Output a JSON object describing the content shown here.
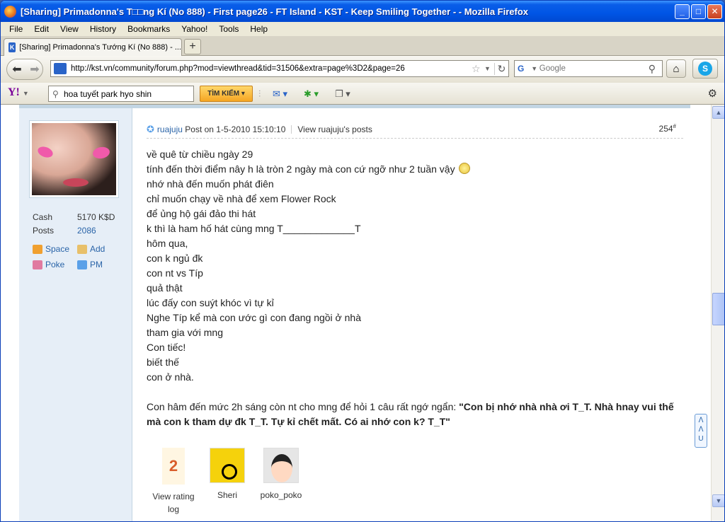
{
  "window": {
    "title": "[Sharing] Primadonna's T□□ng Kí (No 888) - First page26 - FT Island - KST - Keep Smiling Together - - Mozilla Firefox"
  },
  "menu": [
    "File",
    "Edit",
    "View",
    "History",
    "Bookmarks",
    "Yahoo!",
    "Tools",
    "Help"
  ],
  "tab": {
    "label": "[Sharing] Primadonna's Tướng Kí (No 888) - ..."
  },
  "nav": {
    "url": "http://kst.vn/community/forum.php?mod=viewthread&tid=31506&extra=page%3D2&page=26",
    "search_placeholder": "Google"
  },
  "yahoo": {
    "search_value": "hoa tuyết park hyo shin",
    "search_button": "TÌM KIẾM"
  },
  "user": {
    "stats": [
      {
        "label": "Cash",
        "value": "5170 K$D"
      },
      {
        "label": "Posts",
        "value": "2086"
      }
    ],
    "links": [
      "Space",
      "Add",
      "Poke",
      "PM"
    ]
  },
  "post": {
    "author": "ruajuju",
    "posted": "Post on 1-5-2010 15:10:10",
    "view_posts": "View ruajuju's posts",
    "number": "254",
    "number_sup": "#",
    "lines": [
      "về quê từ chiều ngày 29",
      "tính đến thời điểm nây h là tròn 2 ngày mà con cứ ngỡ như 2 tuần vậy",
      "nhớ nhà đến muốn phát điên",
      "chỉ muốn chạy về nhà để xem Flower Rock",
      "để ủng hộ gái đảo thi hát",
      "k thì là ham hố hát cùng mng T_____________T",
      "hôm qua,",
      "con k ngủ đk",
      "con nt vs Típ",
      "quả thật",
      "lúc đấy con suýt khóc vì tự kỉ",
      "Nghe Típ kể mà con ước gì con đang ngồi ở nhà",
      "tham gia với mng",
      "Con tiếc!",
      "biết thế",
      "con ở nhà."
    ],
    "para_start": "Con hâm đến mức 2h sáng còn nt cho mng để hỏi 1 câu rất ngớ ngẩn: ",
    "para_bold_1": "\"Con bị nhớ nhà nhà ơi T_T. Nhà hnay vui thế",
    "para_bold_2": "mà con k tham dự đk T_T. Tự kỉ chết mất. Có ai nhớ con k? T_T\""
  },
  "ratings": {
    "count": "2",
    "log_label_1": "View rating",
    "log_label_2": "log",
    "users": [
      "Sheri",
      "poko_poko"
    ]
  },
  "float_btn": "ᐱ\nᐱ\nU"
}
